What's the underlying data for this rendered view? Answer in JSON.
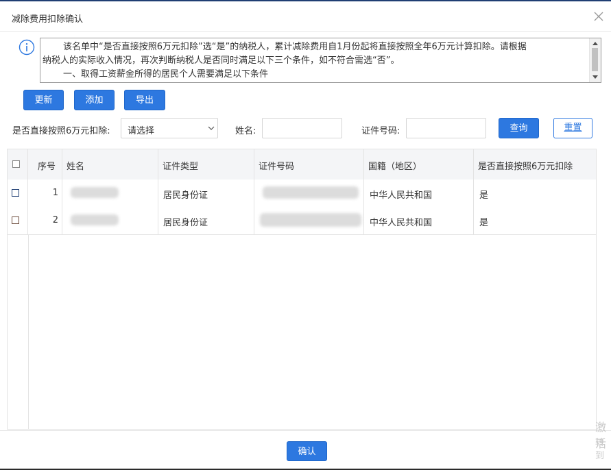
{
  "dialog": {
    "title": "减除费用扣除确认",
    "notice": {
      "line1": "该名单中“是否直接按照6万元扣除”选“是”的纳税人，累计减除费用自1月份起将直接按照全年6万元计算扣除。请根据",
      "line2": "纳税人的实际收入情况，再次判断纳税人是否同时满足以下三个条件，如不符合需选“否”。",
      "line3": "一、取得工资薪金所得的居民个人需要满足以下条件"
    }
  },
  "toolbar": {
    "update": "更新",
    "add": "添加",
    "export": "导出"
  },
  "filters": {
    "deduct_label": "是否直接按照6万元扣除:",
    "deduct_selected": "请选择",
    "name_label": "姓名:",
    "name_value": "",
    "id_label": "证件号码:",
    "id_value": "",
    "query": "查询",
    "reset": "重置"
  },
  "table": {
    "headers": {
      "seq": "序号",
      "name": "姓名",
      "id_type": "证件类型",
      "id_no": "证件号码",
      "nationality": "国籍（地区）",
      "deduct": "是否直接按照6万元扣除"
    },
    "rows": [
      {
        "seq": "1",
        "id_type": "居民身份证",
        "nationality": "中华人民共和国",
        "deduct": "是"
      },
      {
        "seq": "2",
        "id_type": "居民身份证",
        "nationality": "中华人民共和国",
        "deduct": "是"
      }
    ]
  },
  "footer": {
    "confirm": "确认"
  },
  "watermark": {
    "line1": "激活",
    "line2": "转到"
  },
  "colors": {
    "primary": "#2d78e0",
    "header_bg": "#f4f5f7",
    "border": "#e3e3e3"
  }
}
